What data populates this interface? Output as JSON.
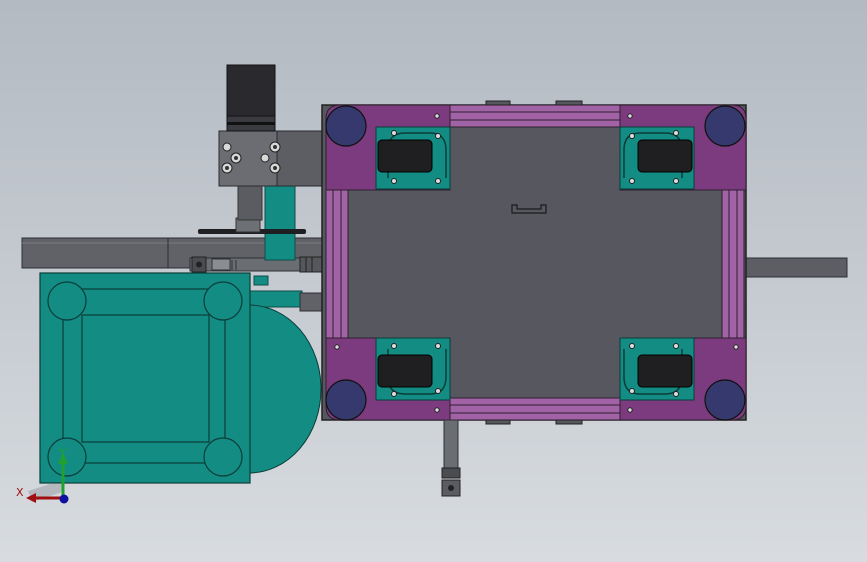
{
  "window": {
    "title": ""
  },
  "colors": {
    "background_top": "#b3bac2",
    "background_bottom": "#d8dce0",
    "frame_purple": "#7c3b7e",
    "rail_purple": "#a263a6",
    "plate_gray": "#56575f",
    "teal": "#138c84",
    "wheel_blue": "#35396e",
    "motor_black": "#2a2a2e",
    "bracket_gray": "#5c5e64",
    "shaft_gray": "#6a6d72"
  },
  "triad": {
    "x_label": "X",
    "y_label": "Y",
    "x_color": "#a01010",
    "y_color": "#20a030",
    "z_color": "#1010a0"
  }
}
